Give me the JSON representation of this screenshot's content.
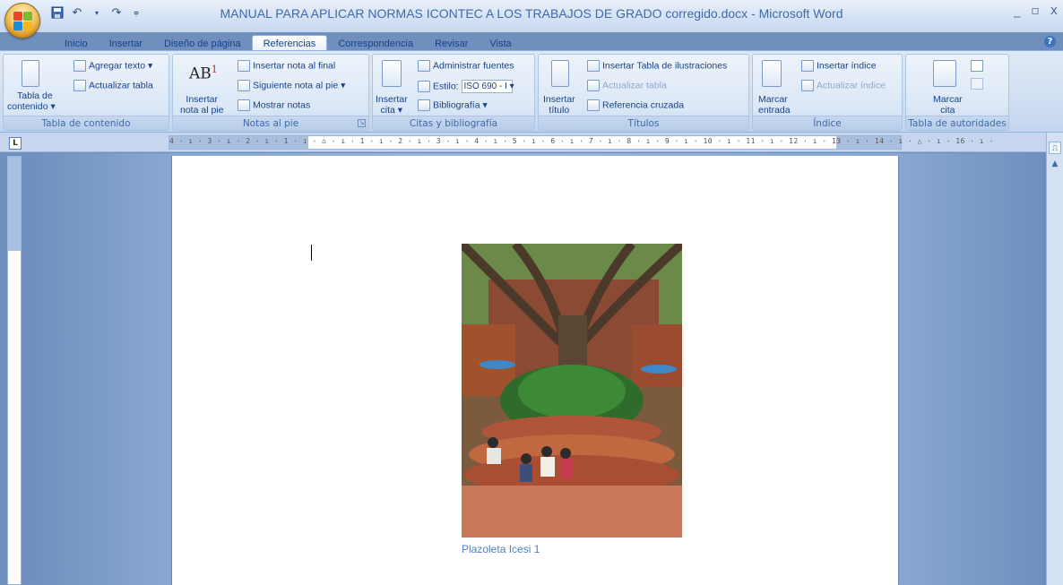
{
  "window": {
    "title": "MANUAL PARA APLICAR NORMAS ICONTEC A LOS TRABAJOS DE GRADO corregido.docx - Microsoft Word",
    "controls": [
      "_",
      "▫",
      "x"
    ]
  },
  "tabs": [
    {
      "label": "Inicio"
    },
    {
      "label": "Insertar"
    },
    {
      "label": "Diseño de página"
    },
    {
      "label": "Referencias",
      "active": true
    },
    {
      "label": "Correspondencia"
    },
    {
      "label": "Revisar"
    },
    {
      "label": "Vista"
    }
  ],
  "ribbon": {
    "toc": {
      "label": "Tabla de contenido",
      "big_button_line1": "Tabla de",
      "big_button_line2": "contenido ▾",
      "add_text": "Agregar texto ▾",
      "update_table": "Actualizar tabla"
    },
    "footnotes": {
      "label": "Notas al pie",
      "big_icon_text": "AB",
      "big_icon_sup": "1",
      "big_button_line1": "Insertar",
      "big_button_line2": "nota al pie",
      "insert_endnote": "Insertar nota al final",
      "next_footnote": "Siguiente nota al pie ▾",
      "show_notes": "Mostrar notas"
    },
    "citations": {
      "label": "Citas y bibliografía",
      "big_button_line1": "Insertar",
      "big_button_line2": "cita ▾",
      "manage_sources": "Administrar fuentes",
      "style_label": "Estilo:",
      "style_value": "ISO 690 - I ▾",
      "bibliography": "Bibliografía ▾"
    },
    "captions": {
      "label": "Títulos",
      "big_button_line1": "Insertar",
      "big_button_line2": "título",
      "insert_table_of_figures": "Insertar Tabla de ilustraciones",
      "update_table": "Actualizar tabla",
      "cross_reference": "Referencia cruzada"
    },
    "index": {
      "label": "Índice",
      "big_button_line1": "Marcar",
      "big_button_line2": "entrada",
      "insert_index": "Insertar índice",
      "update_index": "Actualizar índice"
    },
    "authorities": {
      "label": "Tabla de autoridades",
      "big_button_line1": "Marcar",
      "big_button_line2": "cita"
    }
  },
  "ruler": {
    "text": "4 · ı · 3 · ı · 2 · ı · 1 · ı · ⌂ · ı · 1 · ı · 2 · ı · 3 · ı · 4 · ı · 5 · ı · 6 · ı · 7 · ı · 8 · ı · 9 · ı · 10 · ı · 11 · ı · 12 · ı · 13 · ı · 14 · ı · △ · ı · 16 · ı ·",
    "corner_symbol": "L"
  },
  "document": {
    "figure_caption": "Plazoleta Icesi 1"
  },
  "colors": {
    "accent": "#15428b",
    "caption": "#4f81bd",
    "ribbon": "#dbe7f6"
  }
}
